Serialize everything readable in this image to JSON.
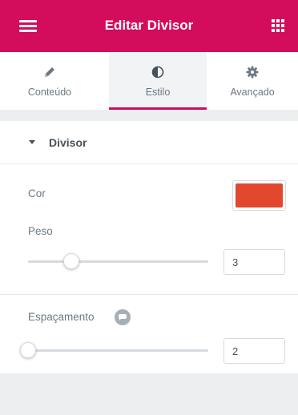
{
  "header": {
    "title": "Editar Divisor",
    "menu_icon": "hamburger-menu-icon",
    "apps_icon": "grid-apps-icon",
    "background": "#d30c5c"
  },
  "tabs": [
    {
      "label": "Conteúdo",
      "icon": "pencil-icon",
      "active": false
    },
    {
      "label": "Estilo",
      "icon": "half-circle-contrast-icon",
      "active": true
    },
    {
      "label": "Avançado",
      "icon": "gear-icon",
      "active": false
    }
  ],
  "section": {
    "title": "Divisor",
    "expanded": true
  },
  "color_control": {
    "label": "Cor",
    "value": "#e2482d"
  },
  "weight_control": {
    "label": "Peso",
    "value": "3",
    "slider_fraction": 0.24
  },
  "spacing_control": {
    "label": "Espaçamento",
    "value": "2",
    "slider_fraction": 0.0,
    "help_icon": "responsive-info-icon"
  },
  "accent_color": "#d30c5c"
}
